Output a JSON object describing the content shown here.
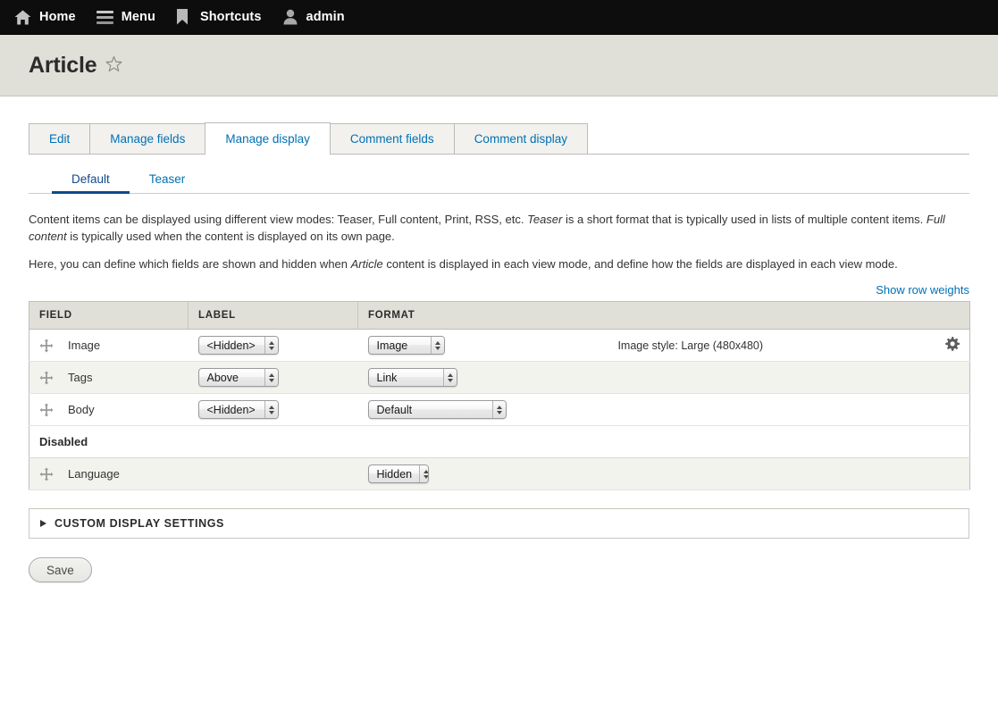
{
  "toolbar": {
    "items": [
      {
        "label": "Home",
        "icon": "home-icon"
      },
      {
        "label": "Menu",
        "icon": "menu-icon"
      },
      {
        "label": "Shortcuts",
        "icon": "bookmark-icon"
      },
      {
        "label": "admin",
        "icon": "user-icon"
      }
    ]
  },
  "header": {
    "title": "Article",
    "star_icon": "star-outline-icon"
  },
  "tabs_primary": [
    {
      "label": "Edit",
      "active": false
    },
    {
      "label": "Manage fields",
      "active": false
    },
    {
      "label": "Manage display",
      "active": true
    },
    {
      "label": "Comment fields",
      "active": false
    },
    {
      "label": "Comment display",
      "active": false
    }
  ],
  "tabs_secondary": [
    {
      "label": "Default",
      "active": true
    },
    {
      "label": "Teaser",
      "active": false
    }
  ],
  "description": {
    "p1_a": "Content items can be displayed using different view modes: Teaser, Full content, Print, RSS, etc. ",
    "p1_em1": "Teaser",
    "p1_b": " is a short format that is typically used in lists of multiple content items. ",
    "p1_em2": "Full content",
    "p1_c": " is typically used when the content is displayed on its own page.",
    "p2_a": "Here, you can define which fields are shown and hidden when ",
    "p2_em": "Article",
    "p2_b": " content is displayed in each view mode, and define how the fields are displayed in each view mode."
  },
  "row_weights_link": "Show row weights",
  "table": {
    "columns": [
      "FIELD",
      "LABEL",
      "FORMAT"
    ],
    "rows": [
      {
        "type": "field",
        "name": "Image",
        "drag_icon": "drag-handle-icon",
        "label_select": "<Hidden>",
        "format_select": "Image",
        "summary": "Image style: Large (480x480)",
        "settings_icon": "gear-icon",
        "stripe": "odd"
      },
      {
        "type": "field",
        "name": "Tags",
        "drag_icon": "drag-handle-icon",
        "label_select": "Above",
        "format_select": "Link",
        "summary": "",
        "settings_icon": "",
        "stripe": "even"
      },
      {
        "type": "field",
        "name": "Body",
        "drag_icon": "drag-handle-icon",
        "label_select": "<Hidden>",
        "format_select": "Default",
        "summary": "",
        "settings_icon": "",
        "stripe": "odd"
      },
      {
        "type": "region",
        "name": "Disabled"
      },
      {
        "type": "field",
        "name": "Language",
        "drag_icon": "drag-handle-icon",
        "label_select": "",
        "format_select": "Hidden",
        "summary": "",
        "settings_icon": "",
        "stripe": "even"
      }
    ]
  },
  "custom_display_settings": {
    "label": "CUSTOM DISPLAY SETTINGS",
    "arrow_icon": "triangle-right-icon",
    "expanded": false
  },
  "save_button": "Save",
  "colors": {
    "toolbar_bg": "#0d0d0d",
    "header_bg": "#e0e0d8",
    "link": "#0071b3",
    "active_tab_underline": "#0f4a8a",
    "row_alt_bg": "#f3f3ee",
    "table_border": "#bebebe"
  }
}
